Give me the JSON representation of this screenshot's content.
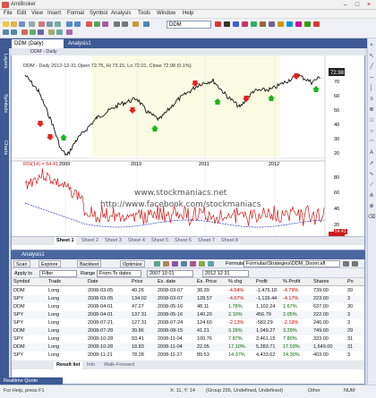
{
  "app": {
    "title": "AmiBroker"
  },
  "menu": [
    "File",
    "Edit",
    "View",
    "Insert",
    "Format",
    "Symbol",
    "Analysis",
    "Tools",
    "Window",
    "Help"
  ],
  "toolbar": {
    "symbol": "DDM"
  },
  "left_tabs": [
    "Layers",
    "Symbols",
    "Charts"
  ],
  "doc_tabs": [
    "DDM (Daily)",
    "Analysis1"
  ],
  "chart": {
    "window_title": "DDM - Daily",
    "price_header": "DDM - Daily 2012-12-31  Open 72.75, Hi 73.15, Lo 72.01, Close 72.98 (0.1%)",
    "last_price": "72.98",
    "y_ticks_price": [
      "70",
      "60",
      "50",
      "40",
      "30",
      "20"
    ],
    "y_ticks_ind": [
      "80",
      "60",
      "40",
      "20"
    ],
    "x_ticks": [
      "2009",
      "2010",
      "2011",
      "2012"
    ],
    "ind_header": "RSI(14) = 54.41",
    "ind_value": "54.41",
    "watermark1": "www.stockmaniacs.net",
    "watermark2": "http://www.facebook.com/stockmaniacs",
    "sheets": [
      "Sheet 1",
      "Sheet 2",
      "Sheet 3",
      "Sheet 4",
      "Sheet 5",
      "Sheet 6",
      "Sheet 7",
      "Sheet 8"
    ]
  },
  "analysis": {
    "title": "Analysis1",
    "buttons": [
      "Scan",
      "Explore",
      "Backtest",
      "Optimize"
    ],
    "apply_label": "Apply to",
    "apply_value": "Filter",
    "range_label": "Range",
    "range_value": "From-To dates",
    "from": "2007 10 01",
    "to": "2012 12 31",
    "formula": "Formula",
    "formula_path": "Formulas\\Strategies\\DDM_Doom.afl",
    "columns": [
      "Symbol",
      "Trade",
      "Date",
      "Price",
      "Ex. date",
      "Ex. Price",
      "% chg",
      "Profit",
      "% Profit",
      "Shares",
      "Po"
    ],
    "rows": [
      [
        "DDM",
        "Long",
        "2008-03-05",
        "40.26",
        "2008-03-07",
        "38.39",
        "-4.64%",
        "-1,476.18",
        "-4.79%",
        "739.00",
        "39"
      ],
      [
        "SPY",
        "Long",
        "2008-03-05",
        "134.02",
        "2008-03-07",
        "128.57",
        "-4.07%",
        "-1,126.44",
        "-4.17%",
        "223.00",
        "3"
      ],
      [
        "DDM",
        "Long",
        "2008-04-01",
        "47.27",
        "2008-05-16",
        "48.11",
        "1.78%",
        "1,102.24",
        "1.67%",
        "637.00",
        "30"
      ],
      [
        "SPY",
        "Long",
        "2008-04-01",
        "137.31",
        "2008-05-16",
        "140.20",
        "2.10%",
        "456.79",
        "2.05%",
        "222.00",
        "3"
      ],
      [
        "SPY",
        "Long",
        "2008-07-21",
        "127.31",
        "2008-07-24",
        "124.60",
        "-2.13%",
        "-582.29",
        "-2.19%",
        "246.00",
        "3"
      ],
      [
        "DDM",
        "Long",
        "2008-07-28",
        "39.86",
        "2008-08-15",
        "41.21",
        "3.39%",
        "1,049.27",
        "3.29%",
        "749.00",
        "29"
      ],
      [
        "SPY",
        "Long",
        "2008-10-28",
        "93.41",
        "2008-11-04",
        "100.76",
        "7.87%",
        "2,461.15",
        "7.80%",
        "333.00",
        "31"
      ],
      [
        "DDM",
        "Long",
        "2008-10-28",
        "18.83",
        "2008-11-04",
        "22.05",
        "17.10%",
        "5,283.71",
        "17.03%",
        "1,649.00",
        "31"
      ],
      [
        "SPY",
        "Long",
        "2008-11-21",
        "78.28",
        "2008-11-27",
        "89.53",
        "14.37%",
        "4,433.62",
        "14.30%",
        "403.00",
        "3"
      ]
    ],
    "bottom_tabs": [
      "Result list",
      "Info",
      "Walk-Forward"
    ]
  },
  "status": {
    "left": "For Help, press F1",
    "mid": "X: 11, Y: 14",
    "group": "(Group 255, Undefined, Undefined)",
    "right": "Other",
    "num": "NUM"
  },
  "colors": {
    "accent": "#3d5a94",
    "up_arrow": "#1bb51b",
    "down_arrow": "#e8201c",
    "price": "#111111",
    "rsi": "#d01818",
    "ma": "#2a38d0"
  }
}
